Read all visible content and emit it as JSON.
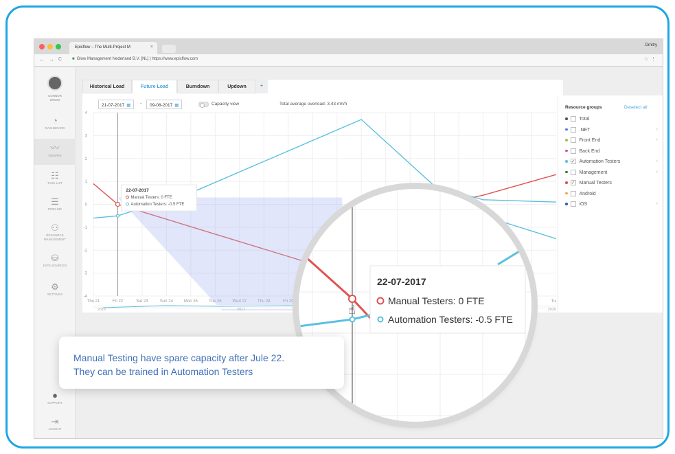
{
  "browser": {
    "tab_title": "Epicflow – The Multi-Project M",
    "tab_close": "×",
    "user": "Dmitry",
    "nav_back": "←",
    "nav_forward": "→",
    "nav_reload": "C",
    "url_org": "Glow Management Nederland B.V. [NL]",
    "url_sep": " | ",
    "url": "https://www.epicflow.com",
    "star": "☆",
    "menu": "⋮"
  },
  "sidebar": {
    "user_name_1": "CONNOR",
    "user_name_2": "WICKS",
    "items": [
      {
        "label": "DASHBOARD",
        "icon": "gauge-icon",
        "glyph": "◔"
      },
      {
        "label": "GRAPHS",
        "icon": "graph-icon",
        "glyph": "〰"
      },
      {
        "label": "TASK LIST",
        "icon": "task-list-icon",
        "glyph": "☷"
      },
      {
        "label": "PIPELINE",
        "icon": "pipeline-icon",
        "glyph": "☰"
      },
      {
        "label": "RESOURCE",
        "label2": "MANAGEMENT",
        "icon": "resource-icon",
        "glyph": "⚇"
      },
      {
        "label": "DATA SOURCES",
        "icon": "database-icon",
        "glyph": "⛁"
      },
      {
        "label": "SETTINGS",
        "icon": "gear-icon",
        "glyph": "⚙"
      },
      {
        "label": "SUPPORT",
        "icon": "chat-icon",
        "glyph": "●"
      },
      {
        "label": "LOGOUT",
        "icon": "logout-icon",
        "glyph": "⇥"
      }
    ]
  },
  "tabs": [
    "Historical Load",
    "Future Load",
    "Burndown",
    "Updown"
  ],
  "add_tab": "+",
  "controls": {
    "date_from": "21-07-2017",
    "date_to": "09-08-2017",
    "date_sep": "-",
    "cal_icon": "▦",
    "capacity_view": "Capacity view",
    "overload": "Total average overload: 3.43 mh/h"
  },
  "chart_data": {
    "type": "line",
    "x": [
      "Thu 21",
      "Fri 22",
      "Sat 23",
      "Sun 24",
      "Mon 25",
      "Tue 26",
      "Wed 27",
      "Thu 28",
      "Fri 29",
      "Sat 30",
      "Sun 31",
      "Mon 1",
      "Tue 2",
      "Wed 3",
      "Thu 4",
      "Fri 5",
      "Sat 6",
      "Sun 7",
      "Mon 8",
      "Tue 9"
    ],
    "ylim": [
      -4,
      4
    ],
    "yticks": [
      "4",
      "3",
      "2",
      "1",
      "0",
      "-1",
      "-2",
      "-3",
      "-4"
    ],
    "series": [
      {
        "name": "Manual Testers",
        "color": "#e0534f",
        "points": [
          [
            0,
            0.9
          ],
          [
            1,
            0
          ],
          [
            9,
            -2.6
          ],
          [
            13,
            -0.3
          ],
          [
            16,
            0.4
          ],
          [
            19,
            1.3
          ]
        ]
      },
      {
        "name": "Automation Testers",
        "color": "#5bc0de",
        "points": [
          [
            0,
            -0.6
          ],
          [
            1,
            -0.5
          ],
          [
            4,
            0.5
          ],
          [
            11,
            3.7
          ],
          [
            14,
            0.8
          ],
          [
            16,
            0.2
          ],
          [
            19,
            0.1
          ]
        ]
      },
      {
        "color": "#5bc0de",
        "points": [
          [
            16,
            -0.5
          ],
          [
            19,
            -1.5
          ]
        ]
      }
    ],
    "overview_x_labels": [
      "2016",
      "2017",
      "2020"
    ],
    "tooltip": {
      "date": "22-07-2017",
      "lines": [
        {
          "name": "Manual Testers: 0 FTE",
          "color": "#e0534f"
        },
        {
          "name": "Automation Testers: -0.5 FTE",
          "color": "#5bc0de"
        }
      ]
    },
    "grid": true
  },
  "zoom": {
    "date": "22-07-2017",
    "manual": "Manual Testers: 0 FTE",
    "automation": "Automation Testers: -0.5 FTE",
    "edge_label": "n 8"
  },
  "resource_groups": {
    "title": "Resource groups",
    "deselect_all": "Deselect all",
    "chevron": "›",
    "check": "✓",
    "items": [
      {
        "label": "Total",
        "color": "#555555",
        "checked": false,
        "expandable": false
      },
      {
        "label": ".NET",
        "color": "#4a7bd4",
        "checked": false,
        "expandable": true
      },
      {
        "label": "Front End",
        "color": "#a6c24a",
        "checked": false,
        "expandable": true
      },
      {
        "label": "Back End",
        "color": "#d04fa8",
        "checked": false,
        "expandable": false
      },
      {
        "label": "Automation Testers",
        "color": "#5bc0de",
        "checked": true,
        "expandable": true
      },
      {
        "label": "Management",
        "color": "#3a7a3a",
        "checked": false,
        "expandable": true
      },
      {
        "label": "Manual Testers",
        "color": "#e0534f",
        "checked": true,
        "expandable": false
      },
      {
        "label": "Android",
        "color": "#f0a04b",
        "checked": false,
        "expandable": false
      },
      {
        "label": "iOS",
        "color": "#3b5fa8",
        "checked": false,
        "expandable": true
      }
    ]
  },
  "callout": {
    "line1": "Manual Testing have spare capacity after Jule 22.",
    "line2": "They can be trained in Automation Testers"
  }
}
